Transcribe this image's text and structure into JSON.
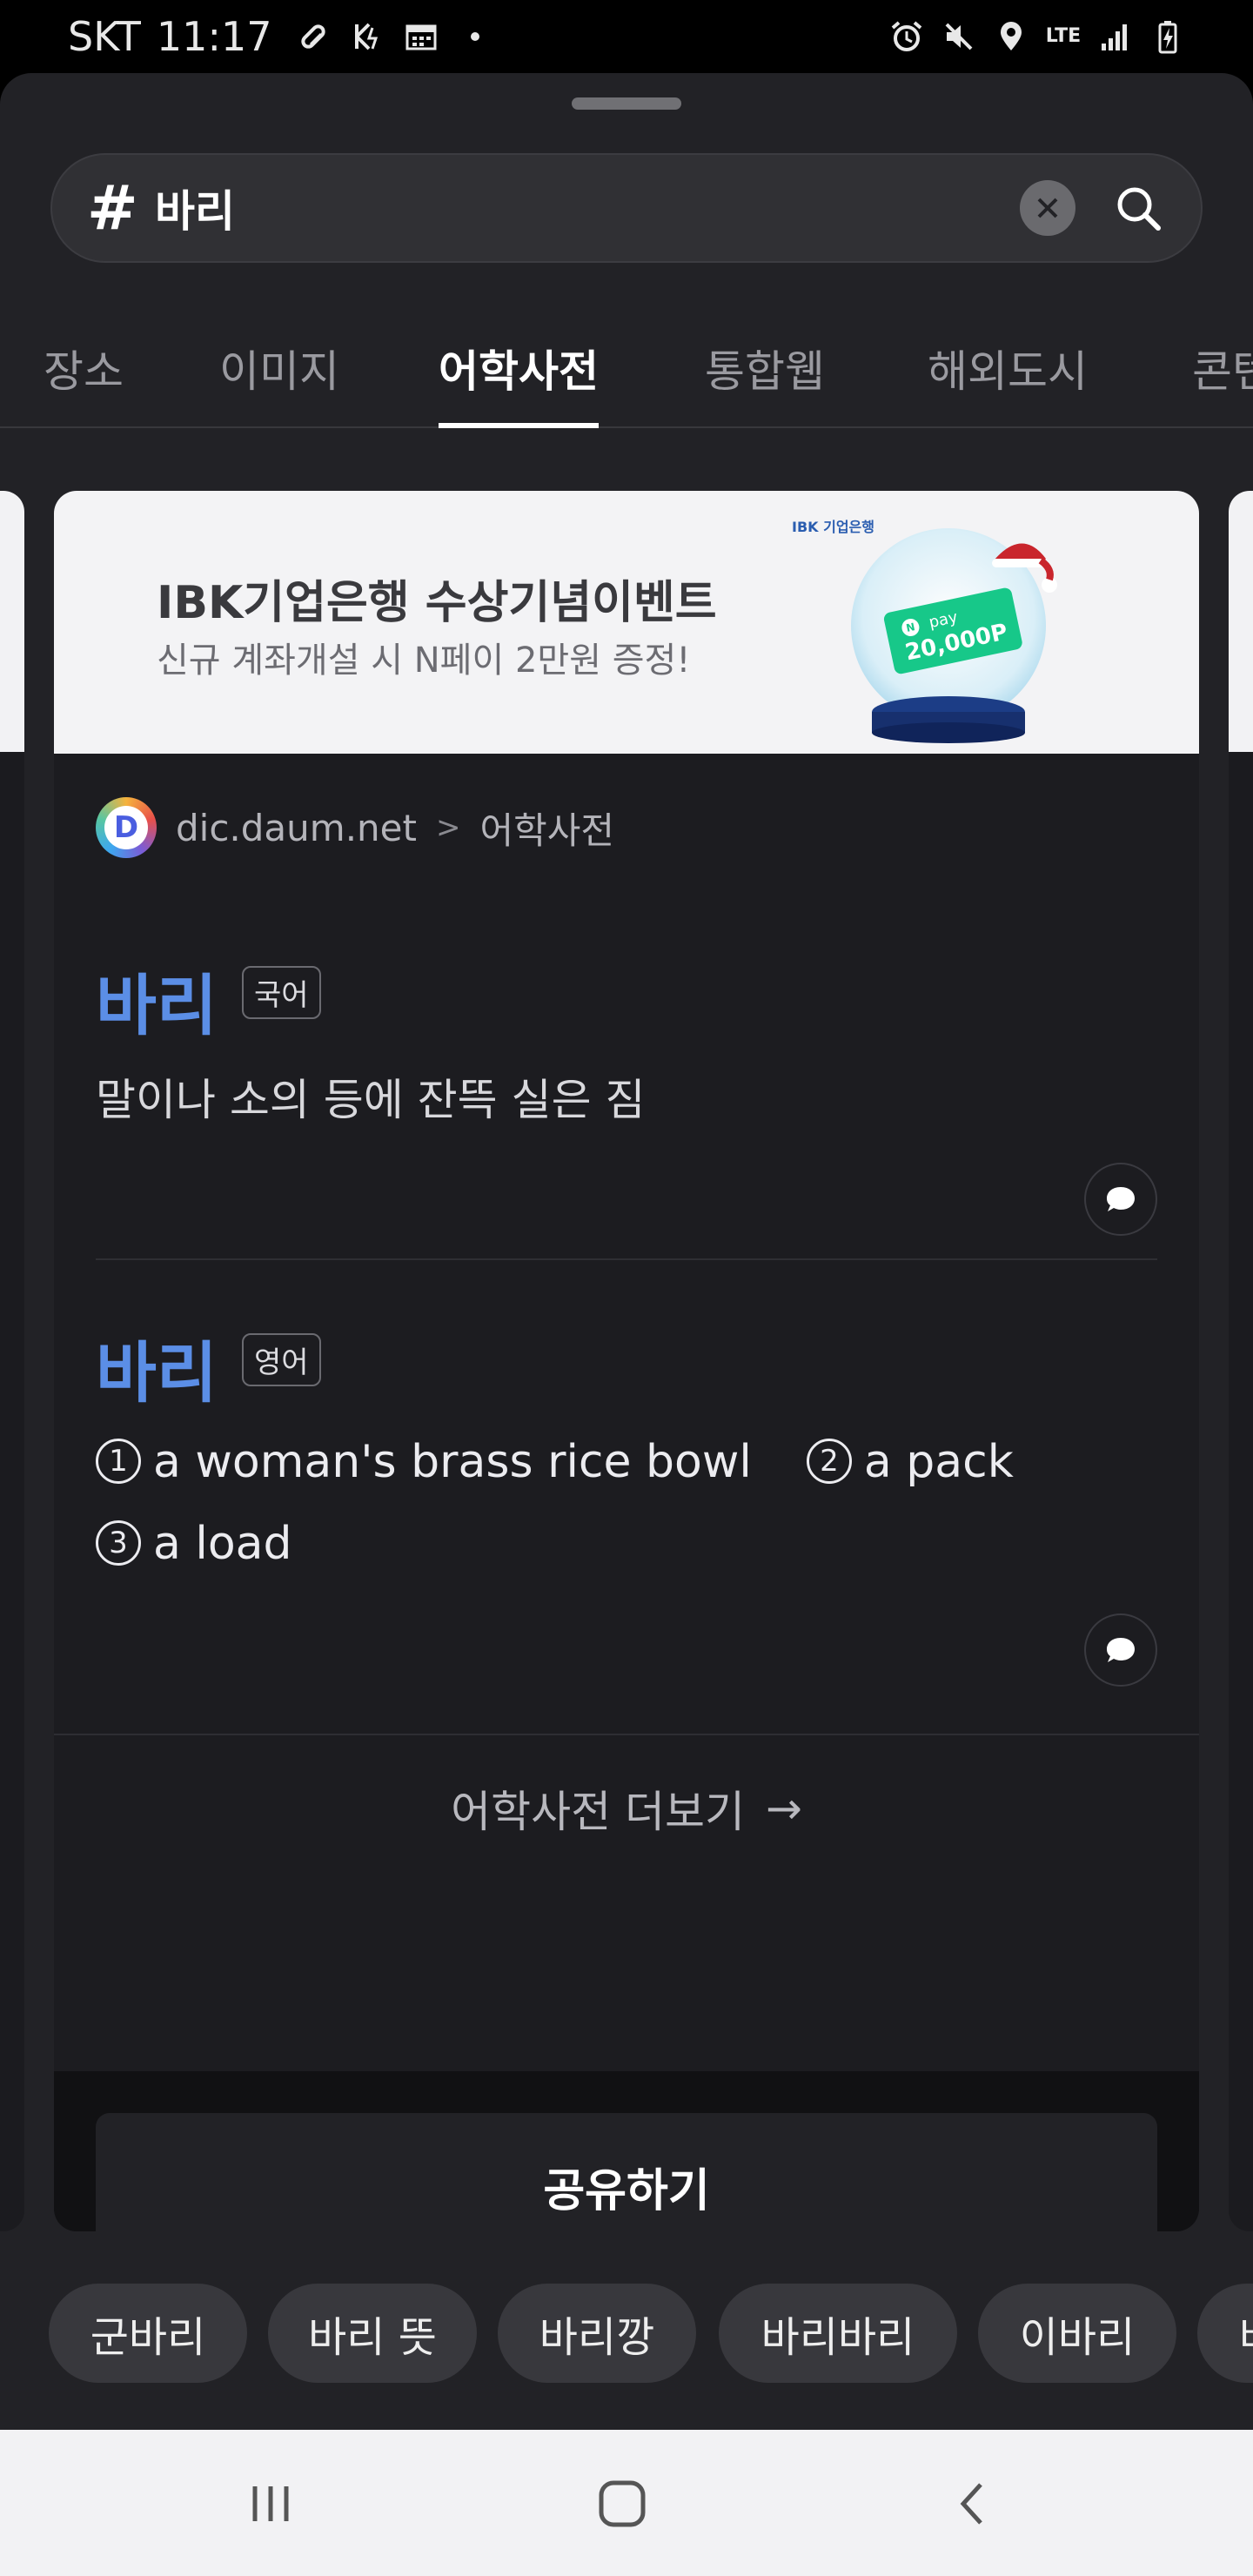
{
  "status_bar": {
    "carrier": "SKT",
    "time": "11:17",
    "network": "LTE",
    "icons_left": [
      "pill-icon",
      "data-saver-icon",
      "calendar-icon",
      "dot-icon"
    ],
    "icons_right": [
      "alarm-icon",
      "mute-icon",
      "location-icon",
      "lte-icon",
      "signal-icon",
      "battery-charging-icon"
    ]
  },
  "search": {
    "hash": "#",
    "query": "바리"
  },
  "tabs": [
    {
      "label": "장소"
    },
    {
      "label": "이미지"
    },
    {
      "label": "어학사전",
      "active": true
    },
    {
      "label": "통합웹"
    },
    {
      "label": "해외도시"
    },
    {
      "label": "콘텐"
    }
  ],
  "banner": {
    "brand": "IBK 기업은행",
    "title": "IBK기업은행 수상기념이벤트",
    "subtitle": "신규 계좌개설 시 N페이 2만원 증정!",
    "coupon_top": "pay",
    "coupon_amount": "20,000P"
  },
  "source": {
    "logo_letter": "D",
    "domain": "dic.daum.net",
    "separator": ">",
    "section": "어학사전"
  },
  "entries": [
    {
      "word": "바리",
      "lang": "국어",
      "definition": "말이나 소의 등에 잔뜩 실은 짐"
    },
    {
      "word": "바리",
      "lang": "영어",
      "defs": [
        {
          "num": "1",
          "text": "a woman's brass rice bowl"
        },
        {
          "num": "2",
          "text": "a pack"
        },
        {
          "num": "3",
          "text": "a load"
        }
      ]
    }
  ],
  "more_link": {
    "label": "어학사전 더보기",
    "arrow": "→"
  },
  "share_button": {
    "label": "공유하기"
  },
  "related": [
    {
      "label": "군바리"
    },
    {
      "label": "바리 뜻"
    },
    {
      "label": "바리깡"
    },
    {
      "label": "바리바리"
    },
    {
      "label": "이바리"
    },
    {
      "label": "바"
    }
  ],
  "colors": {
    "accent_word": "#5b8ee6",
    "sheet_bg": "#222226",
    "card_bg": "#1c1c20",
    "banner_bg": "#f3f3f5"
  }
}
